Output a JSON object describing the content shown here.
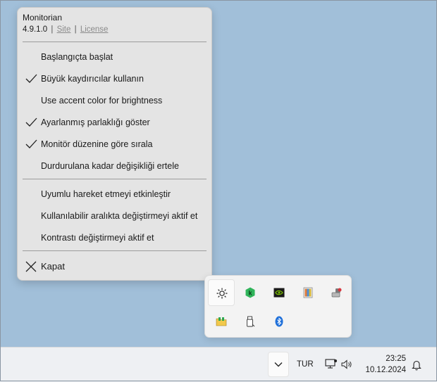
{
  "menu": {
    "app_name": "Monitorian",
    "version": "4.9.1.0",
    "separator": "|",
    "site_link": "Site",
    "license_link": "License",
    "items": [
      {
        "label": "Başlangıçta başlat",
        "checked": false
      },
      {
        "label": "Büyük kaydırıcılar kullanın",
        "checked": true
      },
      {
        "label": "Use accent color for brightness",
        "checked": false
      },
      {
        "label": "Ayarlanmış parlaklığı göster",
        "checked": true
      },
      {
        "label": "Monitör düzenine göre sırala",
        "checked": true
      },
      {
        "label": "Durdurulana kadar değişikliği ertele",
        "checked": false
      },
      {
        "label": "Uyumlu hareket etmeyi etkinleştir",
        "checked": false
      },
      {
        "label": "Kullanılabilir aralıkta değiştirmeyi aktif et",
        "checked": false
      },
      {
        "label": "Kontrastı değiştirmeyi aktif et",
        "checked": false
      }
    ],
    "close_label": "Kapat"
  },
  "tray_icons": [
    {
      "name": "brightness-icon",
      "selected": true
    },
    {
      "name": "kaspersky-icon",
      "selected": false
    },
    {
      "name": "nvidia-icon",
      "selected": false
    },
    {
      "name": "paint-app-icon",
      "selected": false
    },
    {
      "name": "usb-device-icon",
      "selected": false
    },
    {
      "name": "network-folder-icon",
      "selected": false
    },
    {
      "name": "usb-drive-icon",
      "selected": false
    },
    {
      "name": "bluetooth-icon",
      "selected": false
    }
  ],
  "taskbar": {
    "language": "TUR",
    "time": "23:25",
    "date": "10.12.2024"
  },
  "colors": {
    "desktop": "#a1bfd9",
    "menu_bg": "#e4e4e4",
    "kaspersky": "#2fb45a",
    "nvidia": "#76b900",
    "bluetooth": "#1e6fd9"
  }
}
